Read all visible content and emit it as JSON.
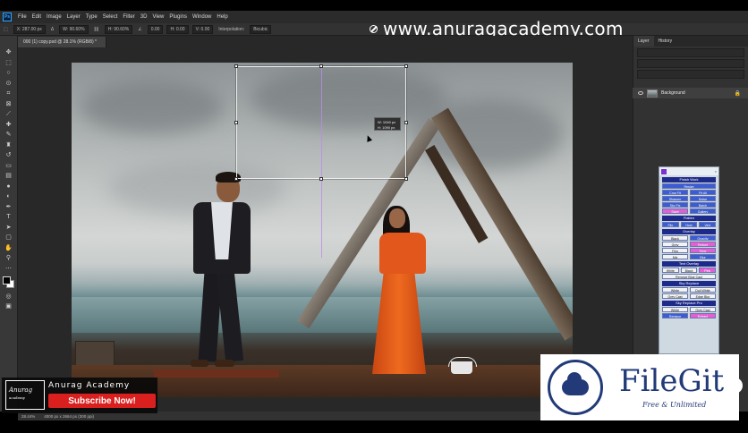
{
  "app": {
    "logo": "Ps"
  },
  "menu": [
    "File",
    "Edit",
    "Image",
    "Layer",
    "Type",
    "Select",
    "Filter",
    "3D",
    "View",
    "Plugins",
    "Window",
    "Help"
  ],
  "options": {
    "x_value": "X: 287.00 px",
    "w_value": "W: 90.60%",
    "h_value": "H: 90.60%",
    "angle": "0.00",
    "h_skew": "H: 0.00",
    "v_skew": "V: 0.00",
    "interpolation_label": "Interpolation:",
    "interpolation_value": "Bicubic"
  },
  "watermark_text": "www.anuragacademy.com",
  "document_tab": "000 (1) copy.psd @ 28.1% (RGB/8) *",
  "transform_tip": {
    "line1": "W: 1040 px",
    "line2": "H: 1090 px"
  },
  "layers_panel": {
    "tabs": [
      "Layer",
      "History"
    ],
    "layer_name": "Background"
  },
  "plugin_panel": {
    "sections": [
      {
        "title": "Finish Work",
        "rows": [
          [
            "Resize"
          ],
          [
            "Crop Fit",
            "Fit All"
          ],
          [
            "Sharpen",
            "Noise"
          ],
          [
            "Sky Fix",
            "Batch"
          ],
          [
            "Save",
            "Gallery"
          ]
        ]
      },
      {
        "title": "Flatten",
        "rows": [
          [
            "Flip",
            "Horz",
            "Vert"
          ]
        ]
      },
      {
        "title": "Overlay",
        "rows": [
          [
            "Black",
            "Opacity"
          ],
          [
            "Grey",
            "Texture"
          ],
          [
            "Film",
            "Tone"
          ],
          [
            "Mix",
            "Blur"
          ]
        ]
      },
      {
        "title": "Text Overlay",
        "rows": [
          [
            "White",
            "Black",
            "Pink"
          ],
          [
            "Remove Blue Cast"
          ]
        ]
      },
      {
        "title": "Sky Replace",
        "rows": [
          [
            "White",
            "Dull White"
          ],
          [
            "Grey Cast",
            "Edge Blur"
          ]
        ]
      },
      {
        "title": "Sky Replace Pro",
        "rows": [
          [
            "White",
            "Grey Cast"
          ],
          [
            "Replace",
            "Extract"
          ]
        ]
      }
    ]
  },
  "status": {
    "zoom": "28.44%",
    "doc_size": "4000 px x 2664 px (300 ppi)"
  },
  "academy": {
    "logo_script": "Anurag",
    "logo_small": "academy",
    "name": "Anurag Academy",
    "subscribe": "Subscribe Now!"
  },
  "filegit": {
    "name": "FileGit",
    "tagline": "Free & Unlimited"
  },
  "colors": {
    "ps_blue": "#31a8ff",
    "plugin_section": "#1e2a8a",
    "subscribe_red": "#d9201f",
    "filegit_navy": "#223a78"
  }
}
